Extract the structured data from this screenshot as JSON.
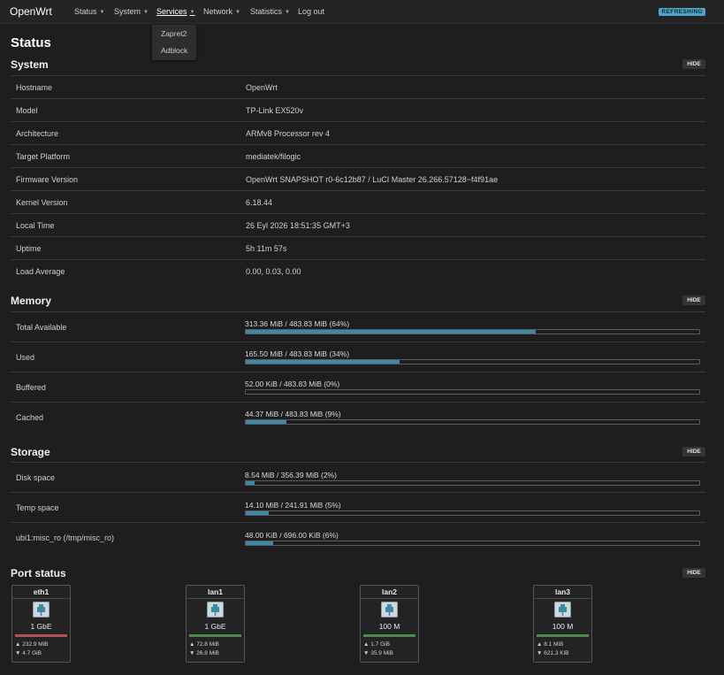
{
  "nav": {
    "brand": "OpenWrt",
    "items": [
      {
        "label": "Status",
        "caret": true,
        "active": false
      },
      {
        "label": "System",
        "caret": true,
        "active": false
      },
      {
        "label": "Services",
        "caret": true,
        "active": true
      },
      {
        "label": "Network",
        "caret": true,
        "active": false
      },
      {
        "label": "Statistics",
        "caret": true,
        "active": false
      },
      {
        "label": "Log out",
        "caret": false,
        "active": false
      }
    ],
    "refresh_badge": "REFRESHING",
    "services_dropdown": [
      "Zapret2",
      "Adblock"
    ]
  },
  "page_title": "Status",
  "hide_label": "HIDE",
  "system": {
    "title": "System",
    "rows": [
      {
        "key": "Hostname",
        "value": "OpenWrt"
      },
      {
        "key": "Model",
        "value": "TP-Link EX520v"
      },
      {
        "key": "Architecture",
        "value": "ARMv8 Processor rev 4"
      },
      {
        "key": "Target Platform",
        "value": "mediatek/filogic"
      },
      {
        "key": "Firmware Version",
        "value": "OpenWrt SNAPSHOT r0-6c12b87 / LuCI Master 26.266.57128~f4f91ae"
      },
      {
        "key": "Kernel Version",
        "value": "6.18.44"
      },
      {
        "key": "Local Time",
        "value": "26 Eyl 2026 18:51:35 GMT+3"
      },
      {
        "key": "Uptime",
        "value": "5h 11m 57s"
      },
      {
        "key": "Load Average",
        "value": "0.00, 0.03, 0.00"
      }
    ]
  },
  "memory": {
    "title": "Memory",
    "rows": [
      {
        "key": "Total Available",
        "value": "313.36 MiB / 483.83 MiB (64%)",
        "percent": 64
      },
      {
        "key": "Used",
        "value": "165.50 MiB / 483.83 MiB (34%)",
        "percent": 34
      },
      {
        "key": "Buffered",
        "value": "52.00 KiB / 483.83 MiB (0%)",
        "percent": 0
      },
      {
        "key": "Cached",
        "value": "44.37 MiB / 483.83 MiB (9%)",
        "percent": 9
      }
    ]
  },
  "storage": {
    "title": "Storage",
    "rows": [
      {
        "key": "Disk space",
        "value": "8.54 MiB / 356.39 MiB (2%)",
        "percent": 2
      },
      {
        "key": "Temp space",
        "value": "14.10 MiB / 241.91 MiB (5%)",
        "percent": 5
      },
      {
        "key": "ubi1:misc_ro (/tmp/misc_ro)",
        "value": "48.00 KiB / 696.00 KiB (6%)",
        "percent": 6
      }
    ]
  },
  "ports": {
    "title": "Port status",
    "items": [
      {
        "name": "eth1",
        "speed": "1 GbE",
        "tx": "▲ 232.9 MiB",
        "rx": "▼ 4.7 GiB",
        "line_color": "#b05252"
      },
      {
        "name": "lan1",
        "speed": "1 GbE",
        "tx": "▲ 72.8 MiB",
        "rx": "▼ 26.8 MiB",
        "line_color": "#4c8a52"
      },
      {
        "name": "lan2",
        "speed": "100 M",
        "tx": "▲ 1.7 GiB",
        "rx": "▼ 35.9 MiB",
        "line_color": "#4c8a52"
      },
      {
        "name": "lan3",
        "speed": "100 M",
        "tx": "▲ 8.1 MiB",
        "rx": "▼ 621.3 KiB",
        "line_color": "#4c8a52"
      }
    ]
  }
}
